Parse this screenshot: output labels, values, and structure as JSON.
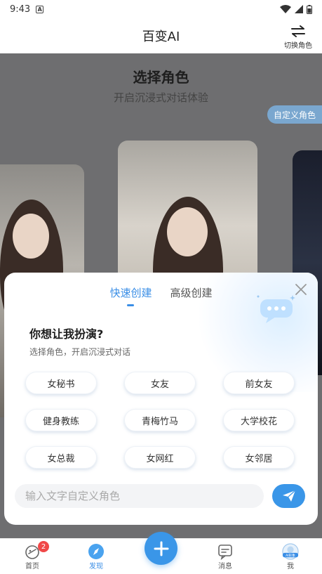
{
  "status_bar": {
    "time": "9:43",
    "notification": "A"
  },
  "header": {
    "title": "百变AI",
    "switch_label": "切换角色",
    "switch_icon": "swap-arrows-icon"
  },
  "hero": {
    "title": "选择角色",
    "subtitle": "开启沉浸式对话体验",
    "custom_role_button": "自定义角色"
  },
  "modal": {
    "tabs": [
      {
        "label": "快速创建",
        "active": true
      },
      {
        "label": "高级创建",
        "active": false
      }
    ],
    "prompt_title": "你想让我扮演?",
    "prompt_subtitle": "选择角色，开启沉浸式对话",
    "roles": [
      "女秘书",
      "女友",
      "前女友",
      "健身教练",
      "青梅竹马",
      "大学校花",
      "女总裁",
      "女网红",
      "女邻居"
    ],
    "input_placeholder": "输入文字自定义角色",
    "accent_color": "#3a8ee6"
  },
  "bottom_nav": {
    "items": [
      {
        "label": "首页",
        "icon": "home-chat-icon",
        "badge": "2"
      },
      {
        "label": "发现",
        "icon": "compass-icon",
        "active": true
      },
      {
        "label": "消息",
        "icon": "message-icon"
      },
      {
        "label": "我",
        "icon": "ai-avatar-icon",
        "avatar_text": "AI形象"
      }
    ],
    "center_icon": "plus-icon"
  }
}
